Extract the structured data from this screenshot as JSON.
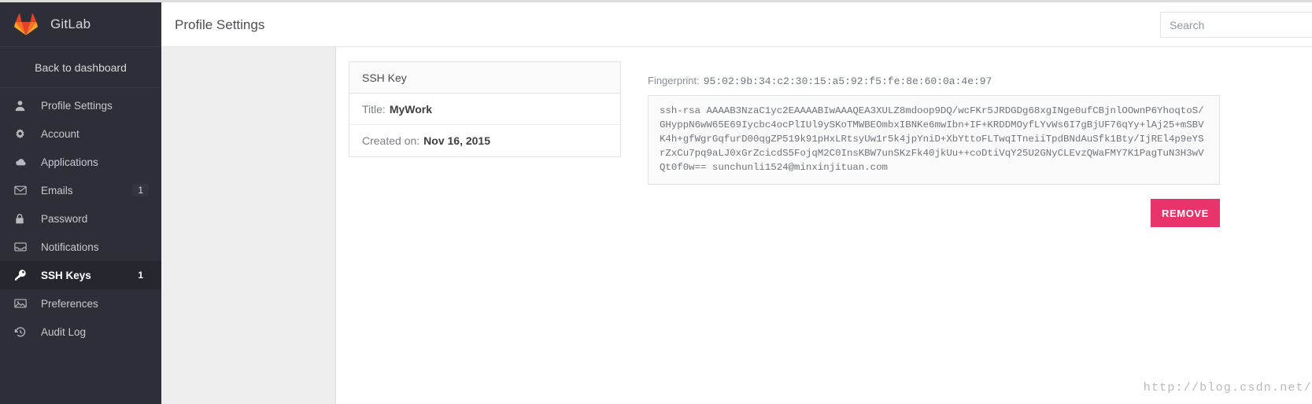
{
  "brand": {
    "name": "GitLab",
    "logo_icon": "gitlab-fox-logo"
  },
  "sidebar": {
    "back_label": "Back to dashboard",
    "items": [
      {
        "label": "Profile Settings",
        "icon": "user-icon",
        "badge": "",
        "active": false
      },
      {
        "label": "Account",
        "icon": "gear-icon",
        "badge": "",
        "active": false
      },
      {
        "label": "Applications",
        "icon": "cloud-icon",
        "badge": "",
        "active": false
      },
      {
        "label": "Emails",
        "icon": "envelope-icon",
        "badge": "1",
        "active": false
      },
      {
        "label": "Password",
        "icon": "lock-icon",
        "badge": "",
        "active": false
      },
      {
        "label": "Notifications",
        "icon": "inbox-icon",
        "badge": "",
        "active": false
      },
      {
        "label": "SSH Keys",
        "icon": "key-icon",
        "badge": "1",
        "active": true
      },
      {
        "label": "Preferences",
        "icon": "image-icon",
        "badge": "",
        "active": false
      },
      {
        "label": "Audit Log",
        "icon": "history-clock-icon",
        "badge": "",
        "active": false
      }
    ]
  },
  "header": {
    "title": "Profile Settings",
    "search_placeholder": "Search",
    "search_value": ""
  },
  "key_card": {
    "heading": "SSH Key",
    "title_label": "Title:",
    "title_value": "MyWork",
    "created_label": "Created on:",
    "created_value": "Nov 16, 2015"
  },
  "key_detail": {
    "fingerprint_label": "Fingerprint:",
    "fingerprint_value": "95:02:9b:34:c2:30:15:a5:92:f5:fe:8e:60:0a:4e:97",
    "key_text": "ssh-rsa AAAAB3NzaC1yc2EAAAABIwAAAQEA3XULZ8mdoop9DQ/wcFKr5JRDGDg68xgINge0ufCBjnlOOwnP6YhoqtoS/GHyppN6wW65E69Iycbc4ocPlIUl9ySKoTMWBEOmbxIBNKe6mwIbn+IF+KRDDMOyfLYvWs6I7gBjUF76qYy+lAj25+mSBVK4h+gfWgrGqfurD00qgZP519k91pHxLRtsyUw1r5k4jpYniD+XbYttoFLTwqITneiiTpdBNdAuSfk1Bty/IjREl4p9eYSrZxCu7pq9aLJ0xGrZcicdS5FojqM2C0InsKBW7unSKzFk40jkUu++coDtiVqY25U2GNyCLEvzQWaFMY7K1PagTuN3H3wVQt0f0w== sunchunli1524@minxinjituan.com",
    "remove_label": "REMOVE"
  },
  "watermark": {
    "text": "http://blog.csdn.net/"
  },
  "colors": {
    "sidebar_bg": "#2e2e38",
    "sidebar_active_bg": "#26262f",
    "remove_button": "#e8336b",
    "gutter_bg": "#eeeeee",
    "logo_orange": "#e24329"
  }
}
